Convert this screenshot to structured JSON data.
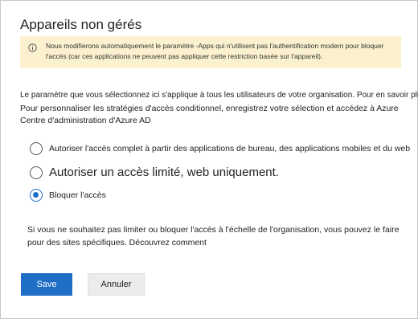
{
  "dialog": {
    "title": "Appareils non gérés"
  },
  "banner": {
    "icon": "info-icon",
    "line1": "Nous modifierons automatiquement le paramètre -Apps qui n'utilisent pas l'authentification modern pour bloquer",
    "line2": "l'accès (car ces applications ne peuvent pas appliquer cette restriction basée sur l'appareil)."
  },
  "description": {
    "line1": "Le paramètre que vous sélectionnez ici s'applique à tous les utilisateurs de votre organisation. Pour en savoir plus.",
    "line2": "Pour personnaliser les stratégies d'accès conditionnel, enregistrez votre sélection et accédez à Azure Centre d'administration d'Azure AD"
  },
  "options": [
    {
      "label": "Autoriser l'accès complet à partir des applications de bureau, des applications mobiles et du web",
      "checked": false
    },
    {
      "label": "Autoriser un accès limité, web uniquement.",
      "checked": false
    },
    {
      "label": "Bloquer l'accès",
      "checked": true
    }
  ],
  "note": {
    "text": "Si vous ne souhaitez pas limiter ou bloquer l'accès à l'échelle de l'organisation, vous pouvez le faire pour des sites spécifiques.",
    "link": "Découvrez comment"
  },
  "buttons": {
    "save": "Save",
    "cancel": "Annuler"
  },
  "colors": {
    "accent": "#1e6ec7",
    "banner_bg": "#fbf1cf"
  }
}
